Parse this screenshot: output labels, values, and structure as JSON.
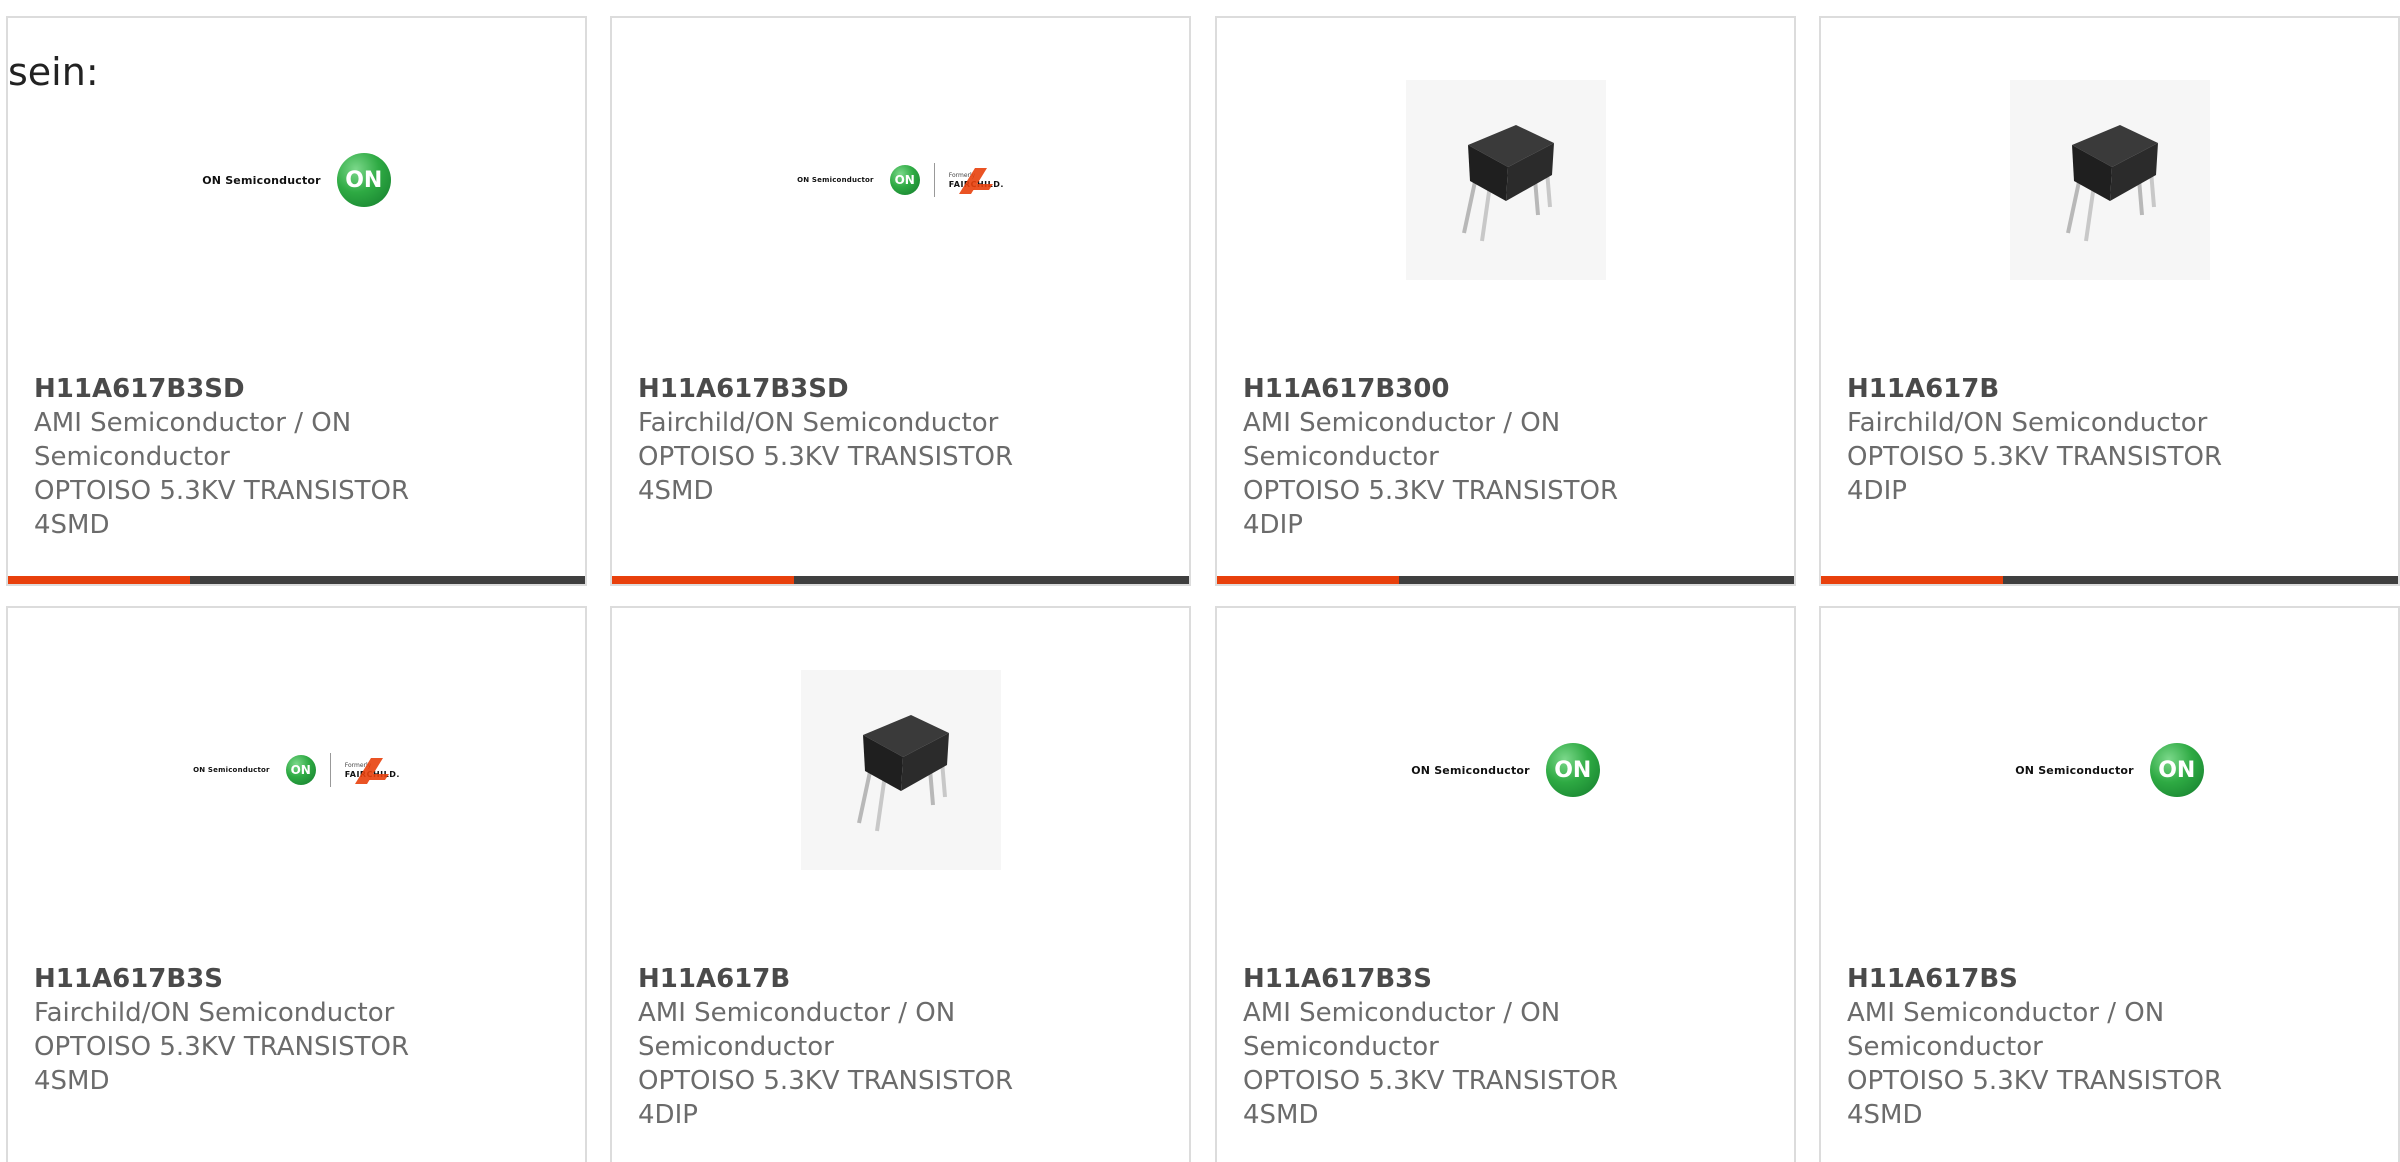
{
  "lead_text": "sein:",
  "cards": [
    {
      "part_number": "H11A617B3SD",
      "manufacturer": "AMI Semiconductor / ON Semiconductor",
      "description": "OPTOISO 5.3KV TRANSISTOR 4SMD",
      "image": "on-semiconductor-logo",
      "logo_text": "ON Semiconductor",
      "logo_badge": "ON"
    },
    {
      "part_number": "H11A617B3SD",
      "manufacturer": "Fairchild/ON Semiconductor",
      "description": "OPTOISO 5.3KV TRANSISTOR 4SMD",
      "image": "on-fairchild-logo",
      "logo_text": "ON Semiconductor",
      "logo_badge": "ON",
      "logo_formerly": "Formerly",
      "logo_fairchild": "FAIRCHILD."
    },
    {
      "part_number": "H11A617B300",
      "manufacturer": "AMI Semiconductor / ON Semiconductor",
      "description": "OPTOISO 5.3KV TRANSISTOR 4DIP",
      "image": "dip-chip-photo"
    },
    {
      "part_number": "H11A617B",
      "manufacturer": "Fairchild/ON Semiconductor",
      "description": "OPTOISO 5.3KV TRANSISTOR 4DIP",
      "image": "dip-chip-photo"
    },
    {
      "part_number": "H11A617B3S",
      "manufacturer": "Fairchild/ON Semiconductor",
      "description": "OPTOISO 5.3KV TRANSISTOR 4SMD",
      "image": "on-fairchild-logo",
      "logo_text": "ON Semiconductor",
      "logo_badge": "ON",
      "logo_formerly": "Formerly",
      "logo_fairchild": "FAIRCHILD."
    },
    {
      "part_number": "H11A617B",
      "manufacturer": "AMI Semiconductor / ON Semiconductor",
      "description": "OPTOISO 5.3KV TRANSISTOR 4DIP",
      "image": "dip-chip-photo"
    },
    {
      "part_number": "H11A617B3S",
      "manufacturer": "AMI Semiconductor / ON Semiconductor",
      "description": "OPTOISO 5.3KV TRANSISTOR 4SMD",
      "image": "on-semiconductor-logo",
      "logo_text": "ON Semiconductor",
      "logo_badge": "ON"
    },
    {
      "part_number": "H11A617BS",
      "manufacturer": "AMI Semiconductor / ON Semiconductor",
      "description": "OPTOISO 5.3KV TRANSISTOR 4SMD",
      "image": "on-semiconductor-logo",
      "logo_text": "ON Semiconductor",
      "logo_badge": "ON"
    }
  ],
  "colors": {
    "accent": "#e8400c",
    "bar": "#3f3f3f",
    "border": "#dcdcdc",
    "logo_green": "#2eaa43"
  }
}
